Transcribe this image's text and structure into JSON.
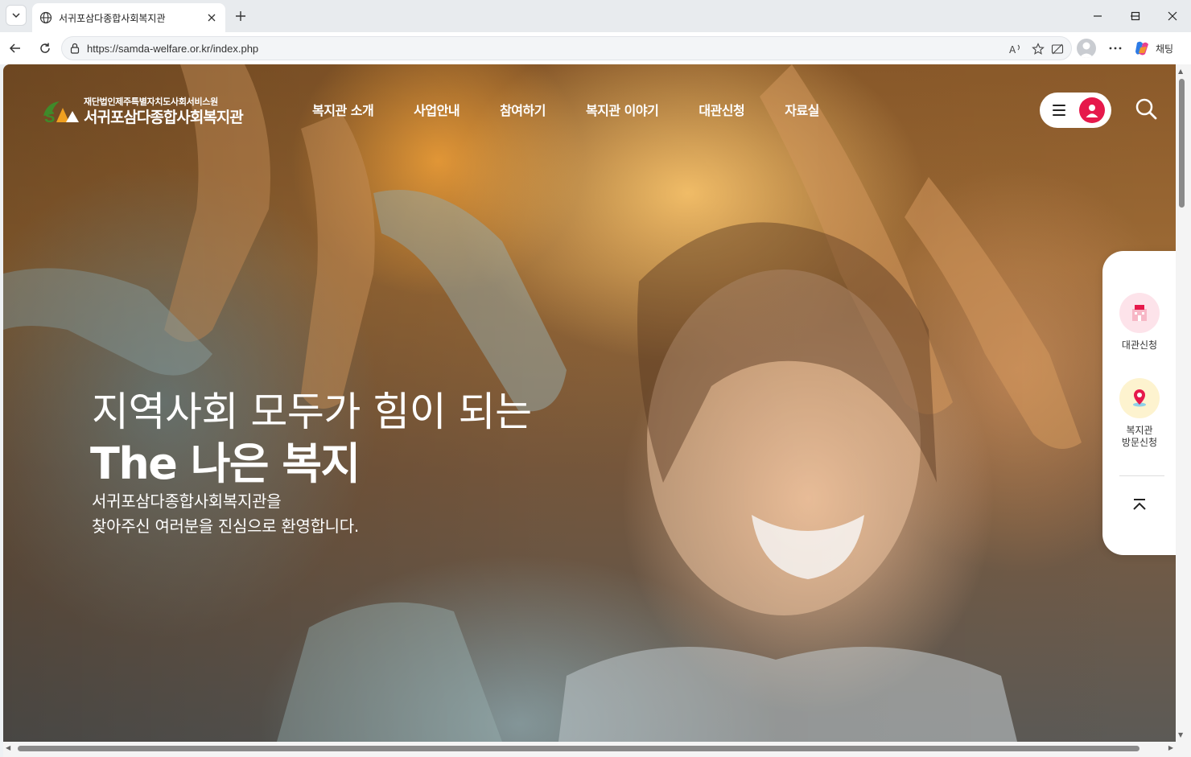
{
  "browser": {
    "tab_title": "서귀포삼다종합사회복지관",
    "url": "https://samda-welfare.or.kr/index.php",
    "copilot_label": "채팅"
  },
  "site": {
    "logo_sub": "재단법인제주특별자치도사회서비스원",
    "logo_main": "서귀포삼다종합사회복지관",
    "nav": [
      "복지관 소개",
      "사업안내",
      "참여하기",
      "복지관 이야기",
      "대관신청",
      "자료실"
    ]
  },
  "hero": {
    "line1": "지역사회 모두가 힘이 되는",
    "line2": "The 나은 복지",
    "desc_line1": "서귀포삼다종합사회복지관을",
    "desc_line2": "찾아주신 여러분을 진심으로 환영합니다."
  },
  "quick_menu": {
    "item1_label": "대관신청",
    "item2_label_line1": "복지관",
    "item2_label_line2": "방문신청"
  },
  "colors": {
    "accent": "#e6194b",
    "logo_green": "#3f8a2a",
    "logo_orange": "#f0a020"
  }
}
